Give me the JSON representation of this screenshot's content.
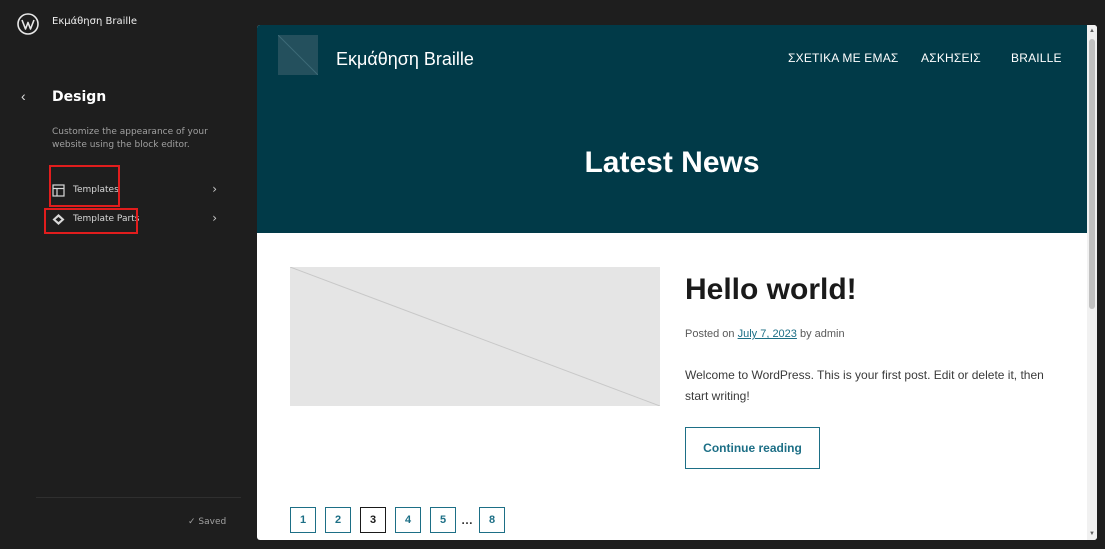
{
  "sidebar": {
    "logo_icon": "wordpress-icon",
    "site_name": "Εκμάθηση Braille",
    "back_icon": "chevron-left-icon",
    "back_glyph": "‹",
    "title": "Design",
    "description": "Customize the appearance of your website using the block editor.",
    "items": [
      {
        "label": "Templates",
        "icon": "layout-icon",
        "chevron": "›"
      },
      {
        "label": "Template Parts",
        "icon": "symbol-filled-icon",
        "chevron": "›"
      }
    ],
    "status": "✓  Saved"
  },
  "preview": {
    "site_title": "Εκμάθηση Braille",
    "nav": [
      "ΣΧΕΤΙΚΑ ΜΕ ΕΜΑΣ",
      "ΑΣΚΗΣΕΙΣ",
      "BRAILLE"
    ],
    "page_title": "Latest News",
    "post": {
      "title": "Hello world!",
      "meta_prefix": "Posted on ",
      "date": "July 7, 2023",
      "meta_by": " by admin",
      "excerpt": "Welcome to WordPress. This is your first post. Edit or delete it, then start writing!",
      "continue_label": "Continue reading"
    },
    "pagination": {
      "pages": [
        "1",
        "2",
        "3",
        "4",
        "5"
      ],
      "ellipsis": "…",
      "last": "8",
      "current": "3"
    },
    "scroll_up": "▲",
    "scroll_down": "▼"
  },
  "colors": {
    "header_bg": "#013a48",
    "accent": "#1d6f86",
    "highlight": "#e11d1d",
    "sidebar_bg": "#1e1e1e"
  }
}
